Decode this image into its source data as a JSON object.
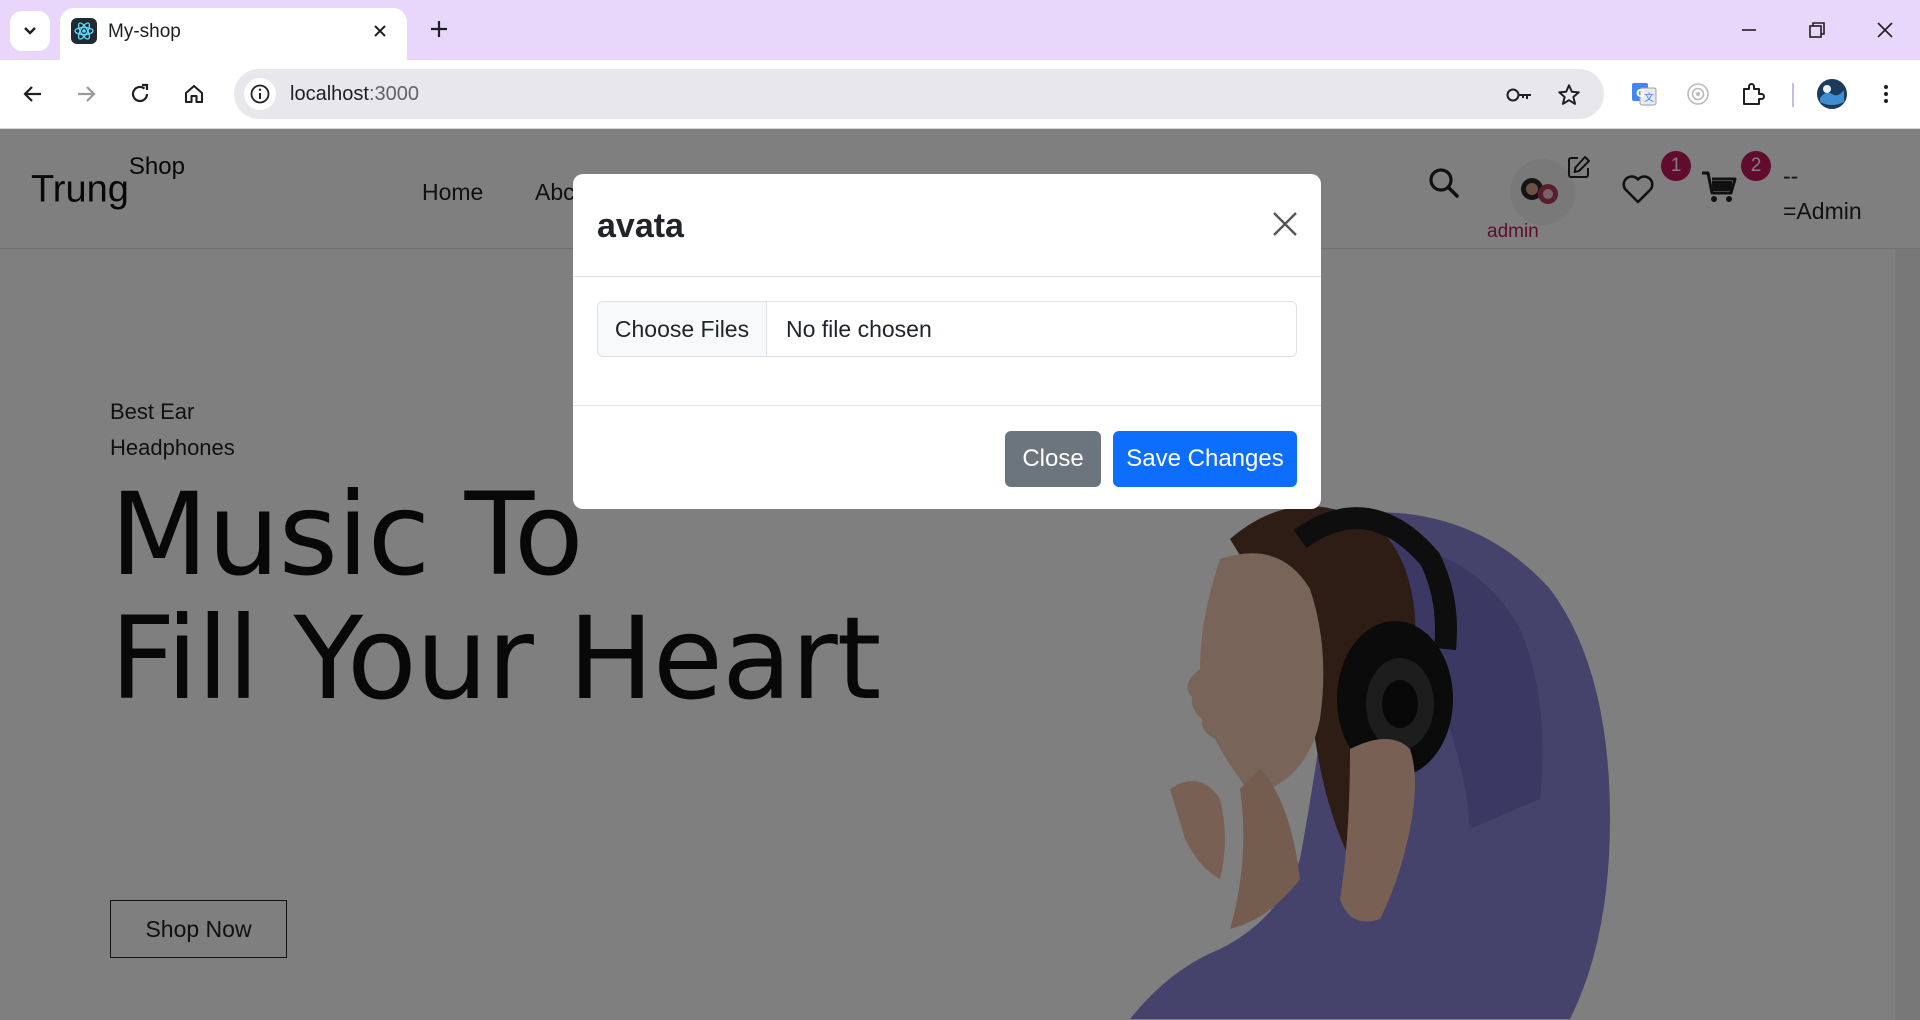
{
  "browser": {
    "tab_title": "My-shop",
    "url_host": "localhost",
    "url_port": ":3000"
  },
  "site": {
    "brand": "Trung",
    "brand_sup": "Shop",
    "nav": [
      "Home",
      "Abc"
    ],
    "wishlist_count": "1",
    "cart_count": "2",
    "admin_name": "admin",
    "role_line1": "--",
    "role_line2": "=Admin"
  },
  "hero": {
    "subtitle_line1": "Best Ear",
    "subtitle_line2": "Headphones",
    "title_line1": "Music To",
    "title_line2": "Fill Your Heart",
    "cta": "Shop Now"
  },
  "modal": {
    "title": "avata",
    "file_button": "Choose Files",
    "file_status": "No file chosen",
    "close_label": "Close",
    "save_label": "Save Changes"
  },
  "colors": {
    "tabbar": "#e9d7fb",
    "badge": "#c2185b",
    "primary": "#0d6efd",
    "secondary": "#6c757d",
    "hoodie": "#8a86d6"
  }
}
